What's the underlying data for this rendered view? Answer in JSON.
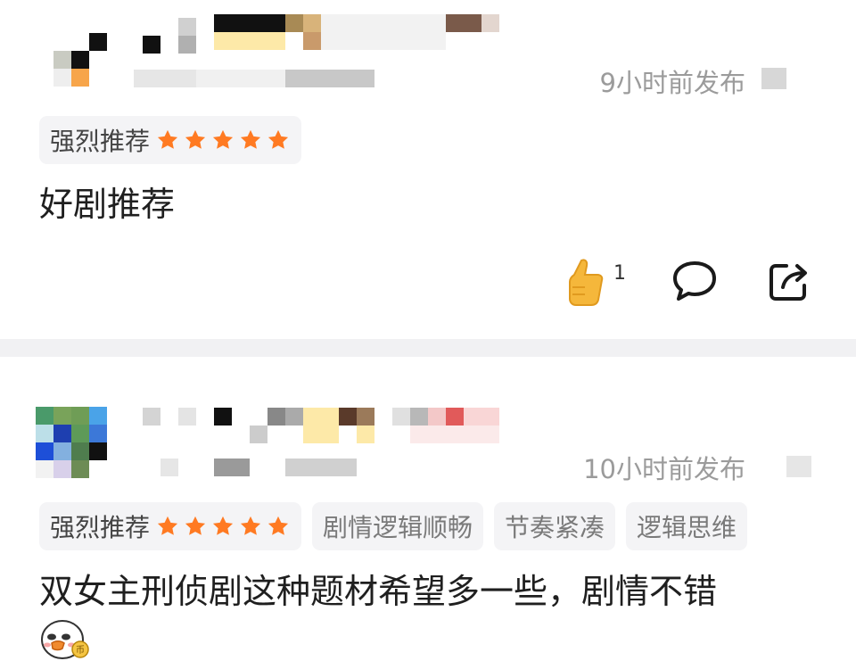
{
  "comments": [
    {
      "time": "9小时前发布",
      "tags": [
        "强烈推荐"
      ],
      "rating": 5,
      "text": "好剧推荐",
      "like_count": "1"
    },
    {
      "time": "10小时前发布",
      "tags": [
        "强烈推荐",
        "剧情逻辑顺畅",
        "节奏紧凑",
        "逻辑思维"
      ],
      "rating": 5,
      "text": "双女主刑侦剧这种题材希望多一些，剧情不错"
    }
  ],
  "icons": {
    "star": "star-icon",
    "like": "thumbs-up-icon",
    "comment": "speech-bubble-icon",
    "share": "share-icon",
    "sticker": "duck-sticker-icon"
  },
  "colors": {
    "star": "#ff7a22",
    "time": "#9b9b9b",
    "tag_bg": "#f4f4f6",
    "separator": "#f1f1f3"
  }
}
